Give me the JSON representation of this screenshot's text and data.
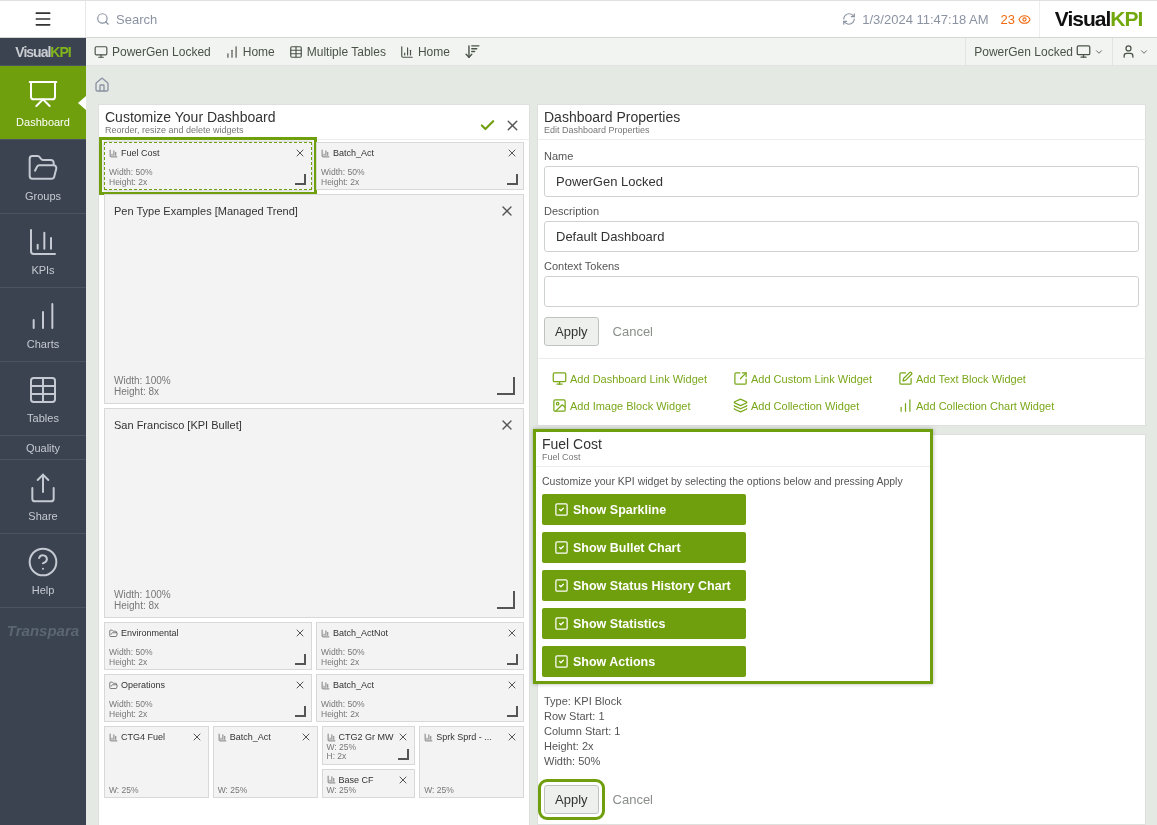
{
  "topbar": {
    "search_placeholder": "Search",
    "timestamp": "1/3/2024 11:47:18 AM",
    "alert_count": "23",
    "logo": [
      "Visual",
      "KPI"
    ]
  },
  "sidebar": {
    "logo": [
      "Visual",
      "KPI"
    ],
    "items": [
      {
        "kind": "dashboard",
        "label": "Dashboard",
        "selected": true
      },
      {
        "kind": "groups",
        "label": "Groups",
        "selected": false
      },
      {
        "kind": "kpis",
        "label": "KPIs",
        "selected": false
      },
      {
        "kind": "charts",
        "label": "Charts",
        "selected": false
      },
      {
        "kind": "tables",
        "label": "Tables",
        "selected": false
      },
      {
        "kind": "plain",
        "label": "Quality",
        "selected": false
      },
      {
        "kind": "share",
        "label": "Share",
        "selected": false
      },
      {
        "kind": "help",
        "label": "Help",
        "selected": false
      }
    ],
    "brand": "Transpara"
  },
  "navbar": {
    "items": [
      {
        "kind": "dashboard",
        "label": "PowerGen Locked"
      },
      {
        "kind": "charts",
        "label": "Home"
      },
      {
        "kind": "tables",
        "label": "Multiple Tables"
      },
      {
        "kind": "kpis",
        "label": "Home"
      },
      {
        "kind": "sort"
      }
    ],
    "dashboard_menu": "PowerGen Locked"
  },
  "customize": {
    "title": "Customize Your Dashboard",
    "subtitle": "Reorder, resize and delete widgets",
    "rows": [
      {
        "kind": "pair",
        "widgets": [
          {
            "kind": "kpi",
            "title": "Fuel Cost",
            "lines": [
              "Width: 50%",
              "Height: 2x"
            ],
            "selected": true
          },
          {
            "kind": "kpi",
            "title": "Batch_Act",
            "lines": [
              "Width: 50%",
              "Height: 2x"
            ],
            "selected": false
          }
        ]
      },
      {
        "kind": "full",
        "widgets": [
          {
            "kind": "chart",
            "title": "Pen Type Examples [Managed Trend]",
            "lines": [
              "Width: 100%",
              "Height: 8x"
            ],
            "selected": false
          }
        ]
      },
      {
        "kind": "full",
        "widgets": [
          {
            "kind": "chart",
            "title": "San Francisco [KPI Bullet]",
            "lines": [
              "Width: 100%",
              "Height: 8x"
            ],
            "selected": false
          }
        ]
      },
      {
        "kind": "pair",
        "widgets": [
          {
            "kind": "group",
            "title": "Environmental",
            "lines": [
              "Width: 50%",
              "Height: 2x"
            ],
            "selected": false
          },
          {
            "kind": "kpi",
            "title": "Batch_ActNot",
            "lines": [
              "Width: 50%",
              "Height: 2x"
            ],
            "selected": false
          }
        ]
      },
      {
        "kind": "pair",
        "widgets": [
          {
            "kind": "group",
            "title": "Operations",
            "lines": [
              "Width: 50%",
              "Height: 2x"
            ],
            "selected": false
          },
          {
            "kind": "kpi",
            "title": "Batch_Act",
            "lines": [
              "Width: 50%",
              "Height: 2x"
            ],
            "selected": false
          }
        ]
      },
      {
        "kind": "quad",
        "widgets": [
          {
            "kind": "kpi",
            "title": "CTG4 Fuel",
            "lines": [
              "W: 25%"
            ],
            "selected": false
          },
          {
            "kind": "kpi",
            "title": "Batch_Act",
            "lines": [
              "W: 25%"
            ],
            "selected": false
          },
          {
            "kind": "stack",
            "items": [
              {
                "kind": "kpi",
                "title": "CTG2 Gr MW",
                "lines": [
                  "W: 25%",
                  "H: 2x"
                ],
                "selected": false
              },
              {
                "kind": "kpi",
                "title": "Base CF",
                "lines": [
                  "W: 25%"
                ],
                "selected": false
              }
            ]
          },
          {
            "kind": "kpi",
            "title": "Sprk Sprd - ...",
            "lines": [
              "W: 25%"
            ],
            "selected": false
          }
        ]
      }
    ]
  },
  "properties": {
    "title": "Dashboard Properties",
    "subtitle": "Edit Dashboard Properties",
    "fields": [
      {
        "label": "Name",
        "value": "PowerGen Locked"
      },
      {
        "label": "Description",
        "value": "Default Dashboard"
      },
      {
        "label": "Context Tokens"
      }
    ],
    "apply": "Apply",
    "cancel": "Cancel",
    "add_links": [
      {
        "kind": "dashboard",
        "label": "Add Dashboard Link Widget"
      },
      {
        "kind": "external",
        "label": "Add Custom Link Widget"
      },
      {
        "kind": "text",
        "label": "Add Text Block Widget"
      },
      {
        "kind": "image",
        "label": "Add Image Block Widget"
      },
      {
        "kind": "collection",
        "label": "Add Collection Widget"
      },
      {
        "kind": "chart",
        "label": "Add Collection Chart Widget"
      }
    ]
  },
  "widget_panel": {
    "title": "Fuel Cost",
    "subtitle": "Fuel Cost",
    "hint": "Customize your KPI widget by selecting the options below and pressing Apply",
    "options": [
      {
        "label": "Show Sparkline",
        "checked": true
      },
      {
        "label": "Show Bullet Chart",
        "checked": true
      },
      {
        "label": "Show Status History Chart",
        "checked": true
      },
      {
        "label": "Show Statistics",
        "checked": true
      },
      {
        "label": "Show Actions",
        "checked": true
      }
    ],
    "details": [
      "Type:  KPI Block",
      "Row Start:  1",
      "Column Start:  1",
      "Height: 2x",
      "Width: 50%"
    ],
    "apply": "Apply",
    "cancel": "Cancel"
  }
}
